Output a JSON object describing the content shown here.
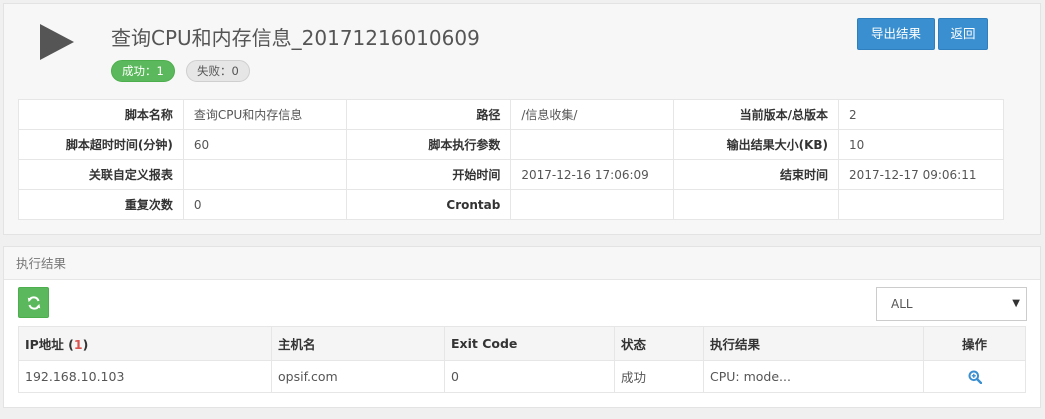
{
  "header": {
    "title": "查询CPU和内存信息_20171216010609",
    "success_badge": "成功：1",
    "fail_badge": "失败：0",
    "export_button": "导出结果",
    "back_button": "返回"
  },
  "info": {
    "rows": [
      [
        {
          "k": "脚本名称",
          "v": "查询CPU和内存信息"
        },
        {
          "k": "路径",
          "v": "/信息收集/"
        },
        {
          "k": "当前版本/总版本",
          "v": "2"
        }
      ],
      [
        {
          "k": "脚本超时时间(分钟)",
          "v": "60"
        },
        {
          "k": "脚本执行参数",
          "v": ""
        },
        {
          "k": "输出结果大小(KB)",
          "v": "10"
        }
      ],
      [
        {
          "k": "关联自定义报表",
          "v": ""
        },
        {
          "k": "开始时间",
          "v": "2017-12-16 17:06:09"
        },
        {
          "k": "结束时间",
          "v": "2017-12-17 09:06:11"
        }
      ],
      [
        {
          "k": "重复次数",
          "v": "0"
        },
        {
          "k": "Crontab",
          "v": ""
        },
        {
          "k": "",
          "v": ""
        }
      ]
    ]
  },
  "results": {
    "panel_title": "执行结果",
    "filter": {
      "selected": "ALL"
    },
    "columns": {
      "ip": "IP地址 (",
      "ip_count": "1",
      "ip_close": ")",
      "hostname": "主机名",
      "exit_code": "Exit Code",
      "status": "状态",
      "result": "执行结果",
      "actions": "操作"
    },
    "rows": [
      {
        "ip": "192.168.10.103",
        "hostname": "opsif.com",
        "exit_code": "0",
        "status": "成功",
        "result": "CPU: mode..."
      }
    ]
  },
  "icons": {
    "play": "play-icon",
    "refresh": "refresh-icon",
    "zoom": "zoom-in-icon",
    "dropdown": "caret-down-icon"
  },
  "colors": {
    "primary": "#3a8fd0",
    "success": "#5cb85c",
    "danger": "#d9534f"
  }
}
